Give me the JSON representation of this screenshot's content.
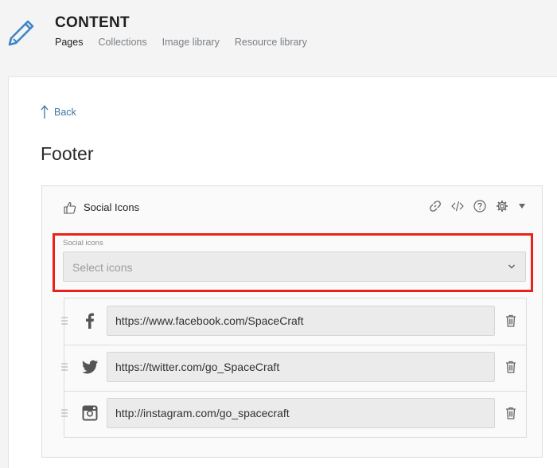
{
  "header": {
    "title": "CONTENT",
    "nav": [
      {
        "label": "Pages",
        "active": true
      },
      {
        "label": "Collections",
        "active": false
      },
      {
        "label": "Image library",
        "active": false
      },
      {
        "label": "Resource library",
        "active": false
      }
    ]
  },
  "back": {
    "label": "Back"
  },
  "page": {
    "title": "Footer"
  },
  "card": {
    "title": "Social Icons",
    "tools": [
      "link-icon",
      "code-icon",
      "help-icon",
      "settings-icon",
      "caret-down-icon"
    ]
  },
  "social_select": {
    "label": "Social icons",
    "placeholder": "Select icons"
  },
  "social_items": [
    {
      "network": "facebook",
      "icon": "facebook-icon",
      "url": "https://www.facebook.com/SpaceCraft"
    },
    {
      "network": "twitter",
      "icon": "twitter-icon",
      "url": "https://twitter.com/go_SpaceCraft"
    },
    {
      "network": "instagram",
      "icon": "instagram-icon",
      "url": "http://instagram.com/go_spacecraft"
    }
  ],
  "colors": {
    "accent_link": "#3d78a8",
    "highlight": "#e8231b",
    "logo": "#3d85c6"
  }
}
